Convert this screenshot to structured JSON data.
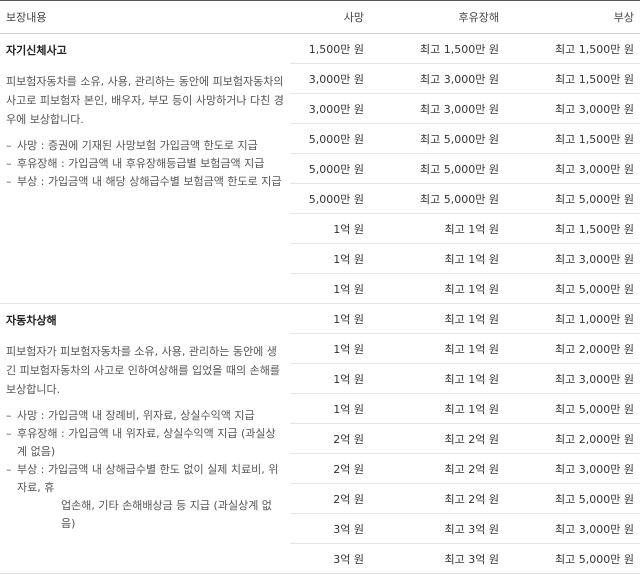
{
  "headers": [
    "보장내용",
    "사망",
    "후유장해",
    "부상"
  ],
  "sections": [
    {
      "title": "자기신체사고",
      "text": "피보험자동차를 소유, 사용, 관리하는 동안에 피보험자동차의 사고로 피보험자 본인, 배우자, 부모 등이 사망하거나 다친 경우에 보상합니다.",
      "bullets": [
        "사망 : 증권에 기재된 사망보험 가입금액 한도로 지급",
        "후유장해 : 가입금액 내 후유장해등급별 보험금액 지급",
        "부상 : 가입금액 내 해당 상해급수별 보험금액 한도로 지급"
      ],
      "bullet_cont": "",
      "rows": [
        [
          "1,500만 원",
          "최고 1,500만 원",
          "최고 1,500만 원"
        ],
        [
          "3,000만 원",
          "최고 3,000만 원",
          "최고 1,500만 원"
        ],
        [
          "3,000만 원",
          "최고 3,000만 원",
          "최고 3,000만 원"
        ],
        [
          "5,000만 원",
          "최고 5,000만 원",
          "최고 1,500만 원"
        ],
        [
          "5,000만 원",
          "최고 5,000만 원",
          "최고 3,000만 원"
        ],
        [
          "5,000만 원",
          "최고 5,000만 원",
          "최고 5,000만 원"
        ],
        [
          "1억 원",
          "최고 1억 원",
          "최고 1,500만 원"
        ],
        [
          "1억 원",
          "최고 1억 원",
          "최고 3,000만 원"
        ],
        [
          "1억 원",
          "최고 1억 원",
          "최고 5,000만 원"
        ]
      ]
    },
    {
      "title": "자동차상해",
      "text": "피보험자가 피보험자동차를 소유, 사용, 관리하는 동안에 생긴 피보험자동차의 사고로 인하여상해를 입었을 때의 손해를 보상합니다.",
      "bullets": [
        "사망 : 가입금액 내 장례비, 위자료, 상실수익액 지급",
        "후유장해 : 가입금액 내 위자료, 상실수익액 지급 (과실상계 없음)",
        "부상 : 가입금액 내 상해급수별 한도 없이 실제 치료비, 위자료, 휴"
      ],
      "bullet_cont": "업손해, 기타 손해배상금 등 지급 (과실상계 없음)",
      "rows": [
        [
          "1억 원",
          "최고 1억 원",
          "최고 1,000만 원"
        ],
        [
          "1억 원",
          "최고 1억 원",
          "최고 2,000만 원"
        ],
        [
          "1억 원",
          "최고 1억 원",
          "최고 3,000만 원"
        ],
        [
          "1억 원",
          "최고 1억 원",
          "최고 5,000만 원"
        ],
        [
          "2억 원",
          "최고 2억 원",
          "최고 2,000만 원"
        ],
        [
          "2억 원",
          "최고 2억 원",
          "최고 3,000만 원"
        ],
        [
          "2억 원",
          "최고 2억 원",
          "최고 5,000만 원"
        ],
        [
          "3억 원",
          "최고 3억 원",
          "최고 3,000만 원"
        ],
        [
          "3억 원",
          "최고 3억 원",
          "최고 5,000만 원"
        ]
      ]
    }
  ]
}
